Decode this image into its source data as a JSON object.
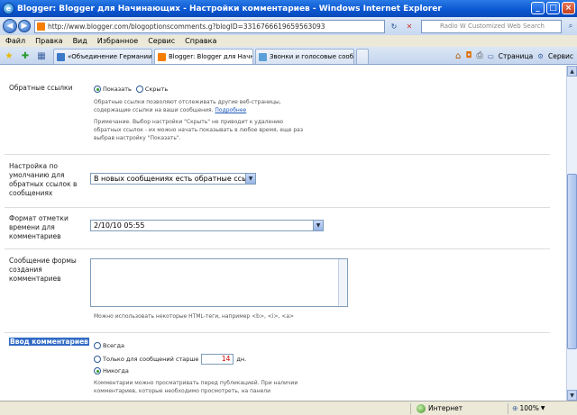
{
  "window": {
    "title": "Blogger: Blogger для Начинающих - Настройки комментариев - Windows Internet Explorer",
    "icon": "ie-icon",
    "controls": {
      "minimize": "_",
      "maximize": "□",
      "close": "×"
    }
  },
  "addressbar": {
    "url": "http://www.blogger.com/blogoptionscomments.g?blogID=3316766619659563093",
    "search_placeholder": "Radio W Customized Web Search"
  },
  "menu": [
    "Файл",
    "Правка",
    "Вид",
    "Избранное",
    "Сервис",
    "Справка"
  ],
  "tabs": [
    {
      "label": "«Объединение Германии: н...",
      "active": false,
      "color": "#3a78c8"
    },
    {
      "label": "Blogger: Blogger для Начн...",
      "active": true,
      "color": "#f57d00"
    },
    {
      "label": "Звонки и голосовые сообщ...",
      "active": false,
      "color": "#5aa0d8"
    }
  ],
  "commandbar": {
    "page": "Страница",
    "tools": "Сервис"
  },
  "settings": {
    "backlinks": {
      "label": "Обратные ссылки",
      "option_show": "Показать",
      "option_hide": "Скрыть",
      "selected": "show",
      "help1": "Обратные ссылки позволяют отслеживать другие веб-страницы,",
      "help2": "содержащие ссылки на ваши сообщения.",
      "help_link": "Подробнее",
      "note1": "Примечание. Выбор настройки \"Скрыть\" не приводит к удалению",
      "note2": "обратных ссылок - их можно начать показывать в любое время, еще раз",
      "note3": "выбрав настройку \"Показать\"."
    },
    "backlinks_default": {
      "label1": "Настройка по",
      "label2": "умолчанию для",
      "label3": "обратных ссылок в",
      "label4": "сообщениях",
      "value": "В новых сообщениях есть обратные ссылки"
    },
    "timestamp": {
      "label1": "Формат отметки",
      "label2": "времени для",
      "label3": "комментариев",
      "value": "2/10/10 05:55"
    },
    "form_message": {
      "label1": "Сообщение формы",
      "label2": "создания",
      "label3": "комментариев",
      "help": "Можно использовать некоторые HTML-теги, например <b>, <i>, <a>"
    },
    "moderation": {
      "label": "Ввод комментариев",
      "option_always": "Всегда",
      "option_older_prefix": "Только для сообщений старше",
      "older_days": "14",
      "option_older_suffix": "дн.",
      "option_never": "Никогда",
      "selected": "never",
      "help1": "Комментарии можно просматривать перед публикацией. При наличии",
      "help2": "комментариев, которые необходимо просмотреть, на панели"
    }
  },
  "statusbar": {
    "zone": "Интернет",
    "zoom": "100%"
  }
}
